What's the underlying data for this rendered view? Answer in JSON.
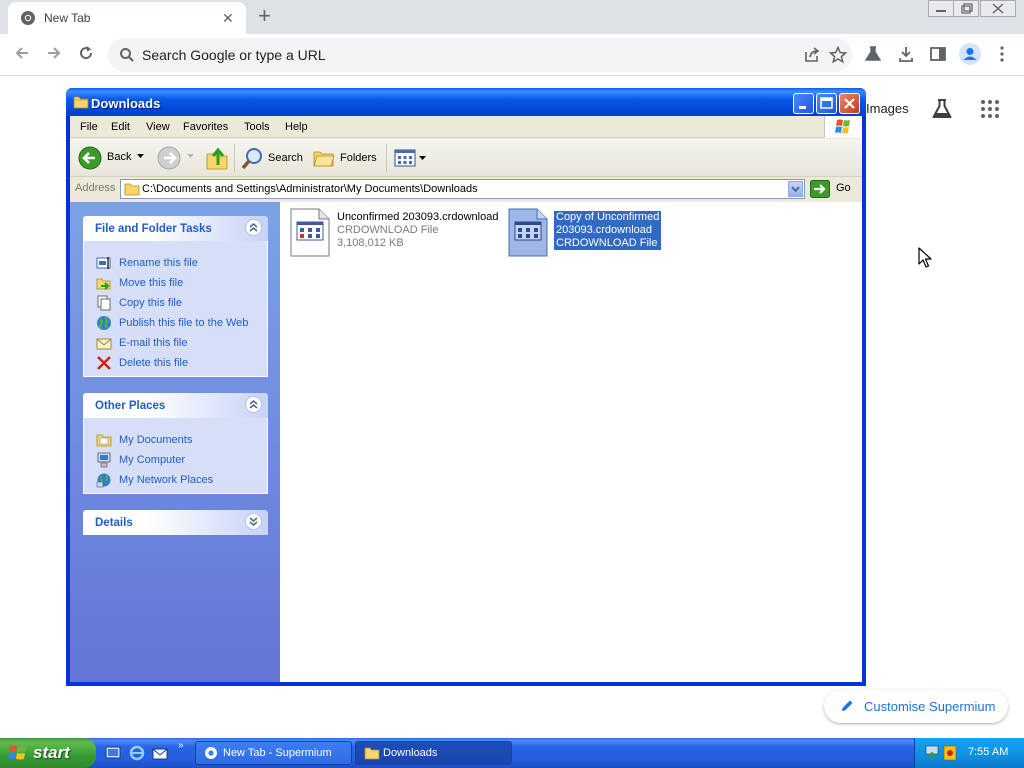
{
  "browser": {
    "tab_title": "New Tab",
    "omnibox_placeholder": "Search Google or type a URL",
    "images_link": "Images",
    "customise_label": "Customise Supermium"
  },
  "explorer": {
    "title": "Downloads",
    "menu": [
      "File",
      "Edit",
      "View",
      "Favorites",
      "Tools",
      "Help"
    ],
    "toolbar": {
      "back": "Back",
      "search": "Search",
      "folders": "Folders"
    },
    "address_label": "Address",
    "address_path": "C:\\Documents and Settings\\Administrator\\My Documents\\Downloads",
    "go_label": "Go",
    "file_tasks": {
      "title": "File and Folder Tasks",
      "items": [
        "Rename this file",
        "Move this file",
        "Copy this file",
        "Publish this file to the Web",
        "E-mail this file",
        "Delete this file"
      ]
    },
    "other_places": {
      "title": "Other Places",
      "items": [
        "My Documents",
        "My Computer",
        "My Network Places"
      ]
    },
    "details": {
      "title": "Details"
    },
    "files": [
      {
        "name": "Unconfirmed 203093.crdownload",
        "type": "CRDOWNLOAD File",
        "size": "3,108,012 KB",
        "selected": false
      },
      {
        "name_line1": "Copy of Unconfirmed",
        "name_line2": "203093.crdownload",
        "type": "CRDOWNLOAD File",
        "selected": true
      }
    ]
  },
  "taskbar": {
    "start_label": "start",
    "buttons": [
      "New Tab - Supermium",
      "Downloads"
    ],
    "clock": "7:55 AM"
  },
  "colors": {
    "xp_title_blue": "#0a58e8",
    "taskbar_blue": "#245edb",
    "start_green": "#379a34",
    "link_blue": "#215dc6",
    "selection_blue": "#316ac5",
    "chrome_accent": "#1a73e8"
  }
}
